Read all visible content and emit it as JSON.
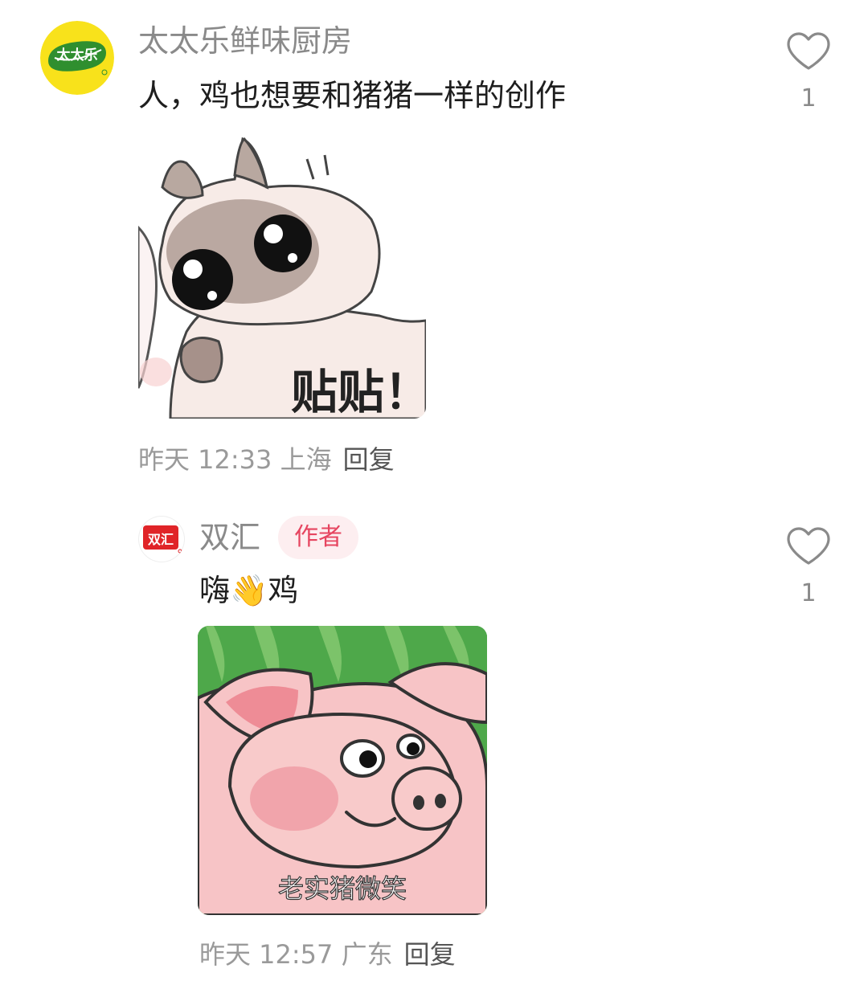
{
  "comments": [
    {
      "username": "太太乐鲜味厨房",
      "avatar_text": "太太乐",
      "text": "人，鸡也想要和猪猪一样的创作",
      "sticker_caption": "贴贴！",
      "meta": "昨天 12:33 上海",
      "reply_label": "回复",
      "like_count": "1"
    },
    {
      "username": "双汇",
      "avatar_text": "双汇",
      "badge": "作者",
      "text_before": "嗨",
      "text_emoji": "👋",
      "text_after": "鸡",
      "sticker_caption": "老实猪微笑",
      "meta": "昨天 12:57 广东",
      "reply_label": "回复",
      "like_count": "1"
    }
  ]
}
